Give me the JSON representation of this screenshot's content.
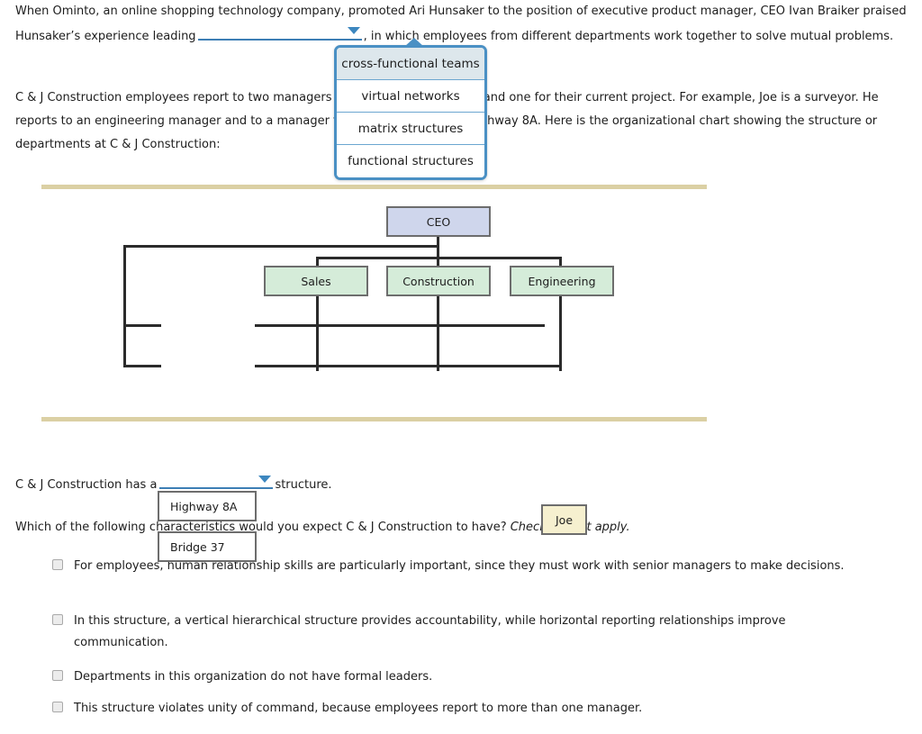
{
  "paragraph1": {
    "before_blank": "When Ominto, an online shopping technology company, promoted Ari Hunsaker to the position of executive product manager, CEO Ivan Braiker praised Hunsaker’s experience leading",
    "blank_value": "",
    "after_blank": ", in which employees from different departments work together to solve mutual problems."
  },
  "paragraph2": {
    "text": "C & J Construction employees report to two managers — one for their specialty and one for their current project. For example, Joe is a surveyor. He reports to an engineering manager and to a manager for his current project: Highway 8A. Here is the organizational chart showing the structure or departments at C & J Construction:"
  },
  "dropdown": {
    "caret_icon": "caret-down-icon",
    "open": true,
    "selected_index": 0,
    "options": [
      "cross-functional teams",
      "virtual networks",
      "matrix structures",
      "functional structures"
    ]
  },
  "org_chart": {
    "nodes": [
      {
        "id": "ceo",
        "label": "CEO",
        "color": "#cfd6ec"
      },
      {
        "id": "sales",
        "label": "Sales",
        "color": "#d5ecd9"
      },
      {
        "id": "construction",
        "label": "Construction",
        "color": "#d5ecd9"
      },
      {
        "id": "engineering",
        "label": "Engineering",
        "color": "#d5ecd9"
      },
      {
        "id": "highway",
        "label": "Highway 8A",
        "color": "#ffffff"
      },
      {
        "id": "bridge",
        "label": "Bridge 37",
        "color": "#ffffff"
      },
      {
        "id": "joe",
        "label": "Joe",
        "color": "#f6f0cf"
      }
    ]
  },
  "answer_sentence": {
    "before_blank": "C & J Construction has a",
    "blank_value": "",
    "after_blank": "structure."
  },
  "question": {
    "prompt": "Which of the following characteristics would you expect C & J Construction to have?",
    "instruction": "Check all that apply."
  },
  "choices": [
    {
      "checked": false,
      "text": "For employees, human relationship skills are particularly important, since they must work with senior managers to make decisions."
    },
    {
      "checked": false,
      "text": "In this structure, a vertical hierarchical structure provides accountability, while horizontal reporting relationships improve communication."
    },
    {
      "checked": false,
      "text": "Departments in this organization do not have formal leaders."
    },
    {
      "checked": false,
      "text": "This structure violates unity of command, because employees report to more than one manager."
    }
  ],
  "colors": {
    "divider": "#dbd0a4",
    "dropdown_border": "#4a90c4",
    "blank_underline": "#3d7fb5",
    "connector": "#2b2b2b"
  }
}
